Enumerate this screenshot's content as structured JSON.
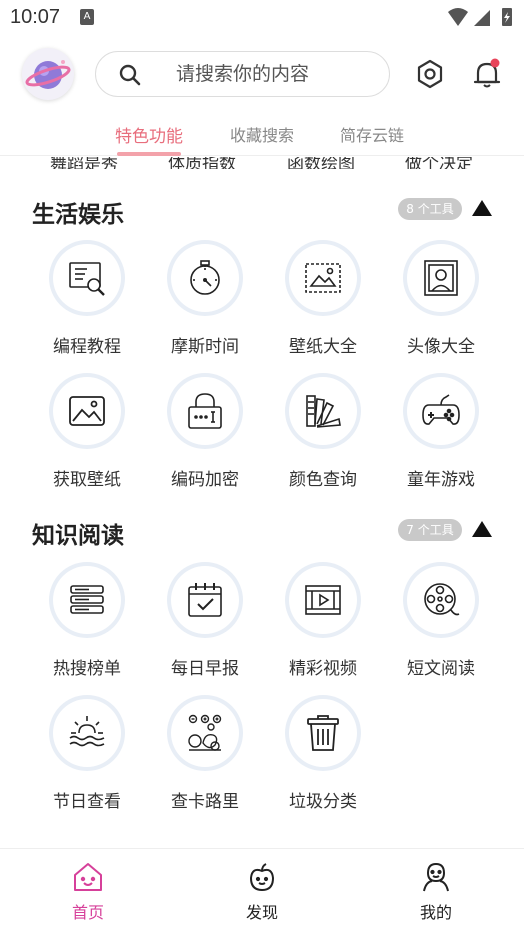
{
  "status_bar": {
    "time": "10:07",
    "badge": "A"
  },
  "search": {
    "placeholder": "请搜索你的内容"
  },
  "tabs": [
    {
      "label": "特色功能",
      "active": true
    },
    {
      "label": "收藏搜索",
      "active": false
    },
    {
      "label": "简存云链",
      "active": false
    }
  ],
  "partial_row": [
    "舞蹈是秀",
    "体质指数",
    "函数绘图",
    "做个决定"
  ],
  "sections": [
    {
      "title": "生活娱乐",
      "count": "8 个工具",
      "tools": [
        {
          "label": "编程教程",
          "icon": "coding-tutorial-icon"
        },
        {
          "label": "摩斯时间",
          "icon": "stopwatch-icon"
        },
        {
          "label": "壁纸大全",
          "icon": "wallpaper-icon"
        },
        {
          "label": "头像大全",
          "icon": "avatar-portrait-icon"
        },
        {
          "label": "获取壁纸",
          "icon": "image-icon"
        },
        {
          "label": "编码加密",
          "icon": "lock-icon"
        },
        {
          "label": "颜色查询",
          "icon": "color-palette-icon"
        },
        {
          "label": "童年游戏",
          "icon": "gamepad-icon"
        }
      ]
    },
    {
      "title": "知识阅读",
      "count": "7 个工具",
      "tools": [
        {
          "label": "热搜榜单",
          "icon": "server-list-icon"
        },
        {
          "label": "每日早报",
          "icon": "calendar-check-icon"
        },
        {
          "label": "精彩视频",
          "icon": "video-icon"
        },
        {
          "label": "短文阅读",
          "icon": "film-reel-icon"
        },
        {
          "label": "节日查看",
          "icon": "sunrise-icon"
        },
        {
          "label": "查卡路里",
          "icon": "calorie-food-icon"
        },
        {
          "label": "垃圾分类",
          "icon": "trash-icon"
        }
      ]
    }
  ],
  "bottom_nav": [
    {
      "label": "首页",
      "icon": "home-icon",
      "active": true
    },
    {
      "label": "发现",
      "icon": "discover-icon",
      "active": false
    },
    {
      "label": "我的",
      "icon": "profile-icon",
      "active": false
    }
  ],
  "colors": {
    "accent": "#e86e7d",
    "nav_active": "#d6409a",
    "badge_bg": "#c9c9c9",
    "notify_dot": "#e8435a"
  }
}
